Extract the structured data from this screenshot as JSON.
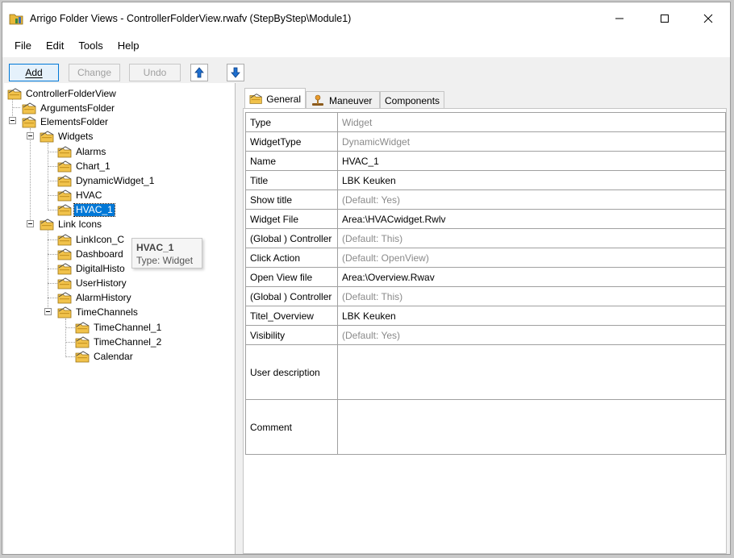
{
  "window": {
    "title": "Arrigo Folder Views - ControllerFolderView.rwafv (StepByStep\\Module1)"
  },
  "menu": [
    "File",
    "Edit",
    "Tools",
    "Help"
  ],
  "toolbar": {
    "add_label": "Add",
    "change_label": "Change",
    "undo_label": "Undo"
  },
  "tree": {
    "root": "ControllerFolderView",
    "arguments": "ArgumentsFolder",
    "elements": "ElementsFolder",
    "widgets": "Widgets",
    "alarms": "Alarms",
    "chart": "Chart_1",
    "dynamic": "DynamicWidget_1",
    "hvac": "HVAC",
    "hvac1": "HVAC_1",
    "linkicons": "Link Icons",
    "linkicon": "LinkIcon_C",
    "dashboard": "Dashboard",
    "digital": "DigitalHisto",
    "userhistory": "UserHistory",
    "alarmhistory": "AlarmHistory",
    "timechannels": "TimeChannels",
    "tc1": "TimeChannel_1",
    "tc2": "TimeChannel_2",
    "calendar": "Calendar"
  },
  "tooltip": {
    "title": "HVAC_1",
    "subtitle": "Type: Widget"
  },
  "tabs": {
    "general": "General",
    "maneuver": "Maneuver",
    "components": "Components"
  },
  "properties": [
    {
      "name": "Type",
      "value": "Widget",
      "muted": true
    },
    {
      "name": "WidgetType",
      "value": "DynamicWidget",
      "muted": true
    },
    {
      "name": "Name",
      "value": "HVAC_1",
      "muted": false
    },
    {
      "name": "Title",
      "value": "LBK Keuken",
      "muted": false
    },
    {
      "name": "Show title",
      "value": "(Default: Yes)",
      "muted": true
    },
    {
      "name": "Widget File",
      "value": "Area:\\HVACwidget.Rwlv",
      "muted": false
    },
    {
      "name": "(Global ) Controller",
      "value": "(Default: This)",
      "muted": true
    },
    {
      "name": "Click Action",
      "value": "(Default: OpenView)",
      "muted": true
    },
    {
      "name": "Open View file",
      "value": "Area:\\Overview.Rwav",
      "muted": false
    },
    {
      "name": "(Global ) Controller",
      "value": "(Default: This)",
      "muted": true
    },
    {
      "name": "Titel_Overview",
      "value": "LBK Keuken",
      "muted": false
    },
    {
      "name": "Visibility",
      "value": "(Default: Yes)",
      "muted": true
    },
    {
      "name": "User description",
      "value": "",
      "muted": false,
      "tall": true
    },
    {
      "name": "Comment",
      "value": "",
      "muted": false,
      "tall": true
    }
  ]
}
